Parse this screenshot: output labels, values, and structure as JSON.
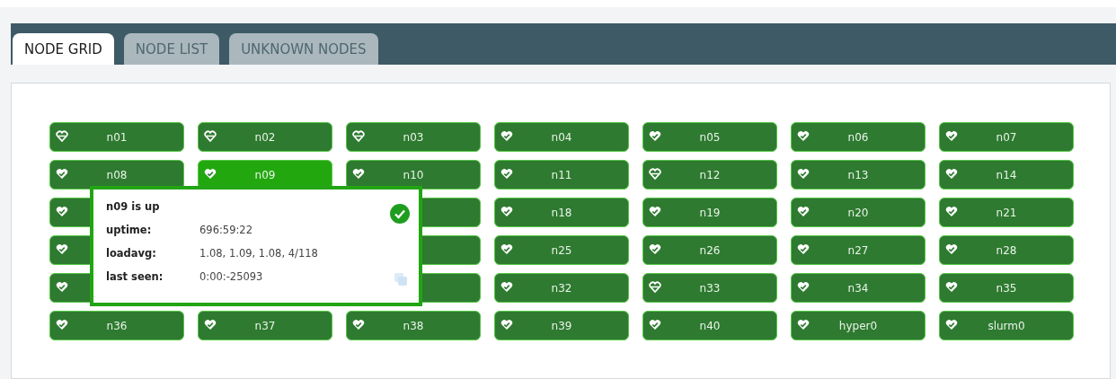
{
  "tabs": [
    {
      "label": "NODE GRID",
      "selected": true
    },
    {
      "label": "NODE LIST",
      "selected": false
    },
    {
      "label": "UNKNOWN NODES",
      "selected": false
    }
  ],
  "nodes": [
    {
      "name": "n01",
      "kind": "plain",
      "selected": false
    },
    {
      "name": "n02",
      "kind": "plain",
      "selected": false
    },
    {
      "name": "n03",
      "kind": "plain",
      "selected": false
    },
    {
      "name": "n04",
      "kind": "check",
      "selected": false
    },
    {
      "name": "n05",
      "kind": "check",
      "selected": false
    },
    {
      "name": "n06",
      "kind": "check",
      "selected": false
    },
    {
      "name": "n07",
      "kind": "check",
      "selected": false
    },
    {
      "name": "n08",
      "kind": "check",
      "selected": false
    },
    {
      "name": "n09",
      "kind": "check",
      "selected": true
    },
    {
      "name": "n10",
      "kind": "check",
      "selected": false
    },
    {
      "name": "n11",
      "kind": "check",
      "selected": false
    },
    {
      "name": "n12",
      "kind": "plain",
      "selected": false
    },
    {
      "name": "n13",
      "kind": "check",
      "selected": false
    },
    {
      "name": "n14",
      "kind": "check",
      "selected": false
    },
    {
      "kind": "check",
      "selected": false
    },
    {
      "kind": "covered"
    },
    {
      "kind": "blank",
      "selected": false
    },
    {
      "name": "n18",
      "kind": "check",
      "selected": false
    },
    {
      "name": "n19",
      "kind": "check",
      "selected": false
    },
    {
      "name": "n20",
      "kind": "check",
      "selected": false
    },
    {
      "name": "n21",
      "kind": "check",
      "selected": false
    },
    {
      "kind": "check",
      "selected": false
    },
    {
      "kind": "covered"
    },
    {
      "kind": "blank",
      "selected": false
    },
    {
      "name": "n25",
      "kind": "check",
      "selected": false
    },
    {
      "name": "n26",
      "kind": "check",
      "selected": false
    },
    {
      "name": "n27",
      "kind": "check",
      "selected": false
    },
    {
      "name": "n28",
      "kind": "check",
      "selected": false
    },
    {
      "kind": "check",
      "selected": false
    },
    {
      "kind": "covered"
    },
    {
      "kind": "blank",
      "selected": false
    },
    {
      "name": "n32",
      "kind": "check",
      "selected": false
    },
    {
      "name": "n33",
      "kind": "plain",
      "selected": false
    },
    {
      "name": "n34",
      "kind": "check",
      "selected": false
    },
    {
      "name": "n35",
      "kind": "check",
      "selected": false
    },
    {
      "name": "n36",
      "kind": "check",
      "selected": false
    },
    {
      "name": "n37",
      "kind": "check",
      "selected": false
    },
    {
      "name": "n38",
      "kind": "check",
      "selected": false
    },
    {
      "name": "n39",
      "kind": "check",
      "selected": false
    },
    {
      "name": "n40",
      "kind": "check",
      "selected": false
    },
    {
      "name": "hyper0",
      "kind": "check",
      "selected": false
    },
    {
      "name": "slurm0",
      "kind": "check",
      "selected": false
    }
  ],
  "tooltip": {
    "title": "n09 is up",
    "rows": [
      {
        "label": "uptime:",
        "value": "696:59:22"
      },
      {
        "label": "loadavg:",
        "value": "1.08, 1.09, 1.08, 4/118"
      },
      {
        "label": "last seen:",
        "value": "0:00:-25093"
      }
    ]
  }
}
